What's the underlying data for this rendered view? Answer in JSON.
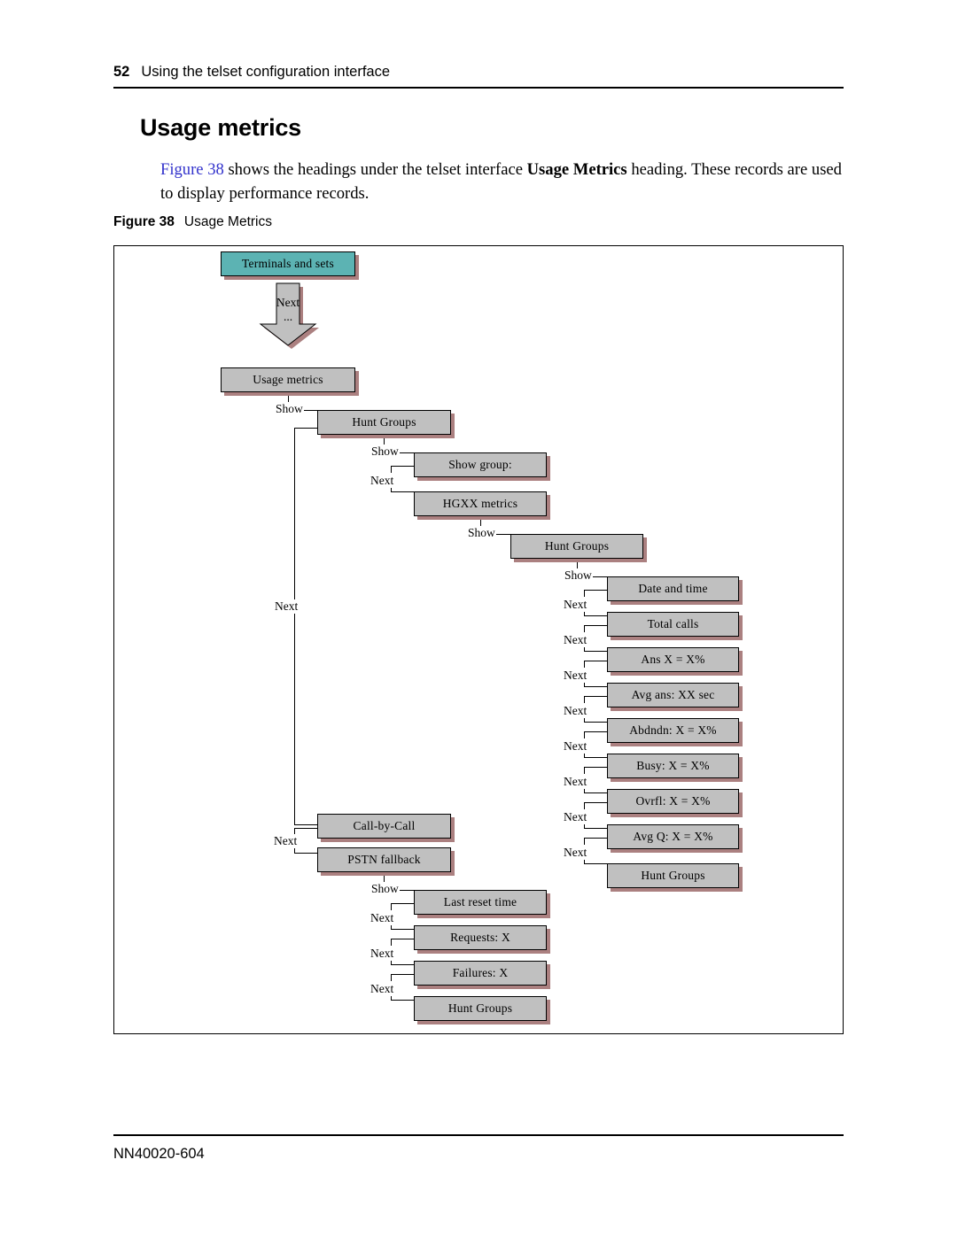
{
  "header": {
    "page_number": "52",
    "running_title": "Using the telset configuration interface"
  },
  "title": "Usage metrics",
  "paragraph": {
    "link_text": "Figure 38",
    "text_part1": " shows the headings under the telset interface ",
    "bold_text": "Usage Metrics",
    "text_part2": " heading. These records are used to display performance records."
  },
  "figure_caption": {
    "number": "Figure 38",
    "label": "Usage Metrics"
  },
  "footer": {
    "doc_number": "NN40020-604"
  },
  "colors": {
    "teal_node": "#5cb3b3",
    "gray_node": "#c0c0c0",
    "node_shadow": "#ab8080",
    "link": "#3333cc",
    "rule": "#000000"
  },
  "diagram": {
    "nodes": [
      {
        "id": "terminals-and-sets",
        "label": "Terminals and sets",
        "style": "teal"
      },
      {
        "id": "arrow-next",
        "label": "Next",
        "sublabel": "...",
        "style": "arrow"
      },
      {
        "id": "usage-metrics",
        "label": "Usage metrics",
        "style": "gray"
      },
      {
        "id": "hunt-groups-1",
        "label": "Hunt Groups",
        "style": "gray"
      },
      {
        "id": "show-group",
        "label": "Show group:",
        "style": "gray"
      },
      {
        "id": "hgxx-metrics",
        "label": "HGXX metrics",
        "style": "gray"
      },
      {
        "id": "hunt-groups-2",
        "label": "Hunt Groups",
        "style": "gray"
      },
      {
        "id": "date-and-time",
        "label": "Date and time",
        "style": "gray"
      },
      {
        "id": "total-calls",
        "label": "Total calls",
        "style": "gray"
      },
      {
        "id": "ans",
        "label": "Ans X = X%",
        "style": "gray"
      },
      {
        "id": "avg-ans",
        "label": "Avg ans: XX sec",
        "style": "gray"
      },
      {
        "id": "abdndn",
        "label": "Abdndn: X = X%",
        "style": "gray"
      },
      {
        "id": "busy",
        "label": "Busy: X = X%",
        "style": "gray"
      },
      {
        "id": "ovrfl",
        "label": "Ovrfl: X = X%",
        "style": "gray"
      },
      {
        "id": "avg-q",
        "label": "Avg Q: X = X%",
        "style": "gray"
      },
      {
        "id": "hunt-groups-3",
        "label": "Hunt Groups",
        "style": "gray"
      },
      {
        "id": "call-by-call",
        "label": "Call-by-Call",
        "style": "gray"
      },
      {
        "id": "pstn-fallback",
        "label": "PSTN fallback",
        "style": "gray"
      },
      {
        "id": "last-reset-time",
        "label": "Last reset time",
        "style": "gray"
      },
      {
        "id": "requests",
        "label": "Requests: X",
        "style": "gray"
      },
      {
        "id": "failures",
        "label": "Failures: X",
        "style": "gray"
      },
      {
        "id": "hunt-groups-4",
        "label": "Hunt Groups",
        "style": "gray"
      }
    ],
    "edge_labels": {
      "show_1": "Show",
      "next_1": "Next",
      "show_2": "Show",
      "next_2": "Next",
      "show_3": "Show",
      "show_4": "Show",
      "next_3": "Next",
      "next_4": "Next",
      "next_5": "Next",
      "next_6": "Next",
      "next_7": "Next",
      "next_8": "Next",
      "next_9": "Next",
      "next_10": "Next",
      "next_11": "Next",
      "next_12": "Next",
      "show_5": "Show",
      "next_13": "Next",
      "next_14": "Next",
      "next_15": "Next"
    }
  }
}
